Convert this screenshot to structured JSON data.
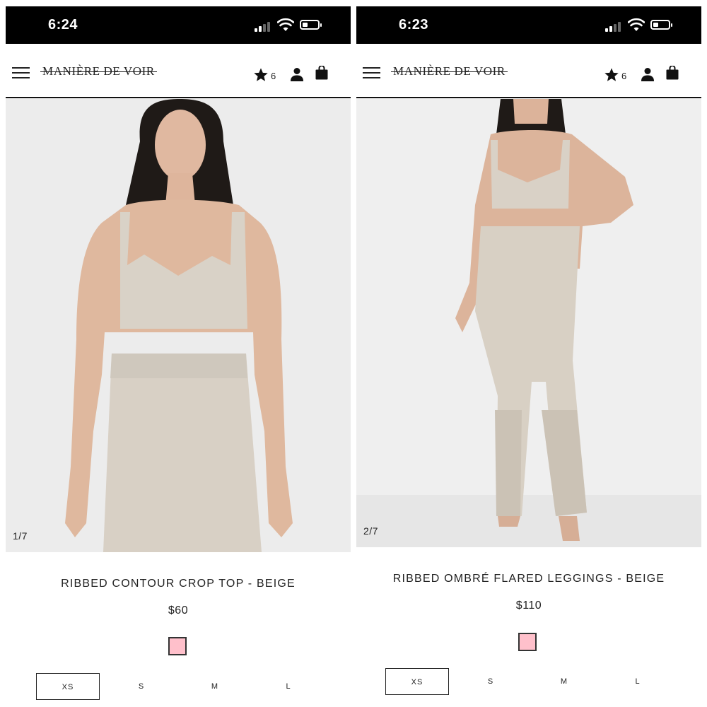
{
  "status_bar": {
    "left_time": "6:24",
    "right_time": "6:23",
    "text_color": "#ffffff",
    "background": "#000000"
  },
  "header": {
    "logo": "MANIÈRE DE VOIR",
    "wishlist_count": "6",
    "icons": [
      "menu-icon",
      "star-icon",
      "account-icon",
      "shopping-bag-icon"
    ]
  },
  "products": [
    {
      "image_counter": "1/7",
      "name": "RIBBED CONTOUR CROP TOP - BEIGE",
      "price": "$60",
      "swatch_color": "#ffc0cb",
      "sizes": [
        "XS",
        "S",
        "M",
        "L"
      ],
      "selected_size": "XS"
    },
    {
      "image_counter": "2/7",
      "name": "RIBBED OMBRÉ FLARED LEGGINGS - BEIGE",
      "price": "$110",
      "swatch_color": "#ffc0cb",
      "sizes": [
        "XS",
        "S",
        "M",
        "L"
      ],
      "selected_size": "XS"
    }
  ],
  "colors": {
    "garment_beige": "#d8d1c6",
    "photo_background": "#ededed"
  }
}
